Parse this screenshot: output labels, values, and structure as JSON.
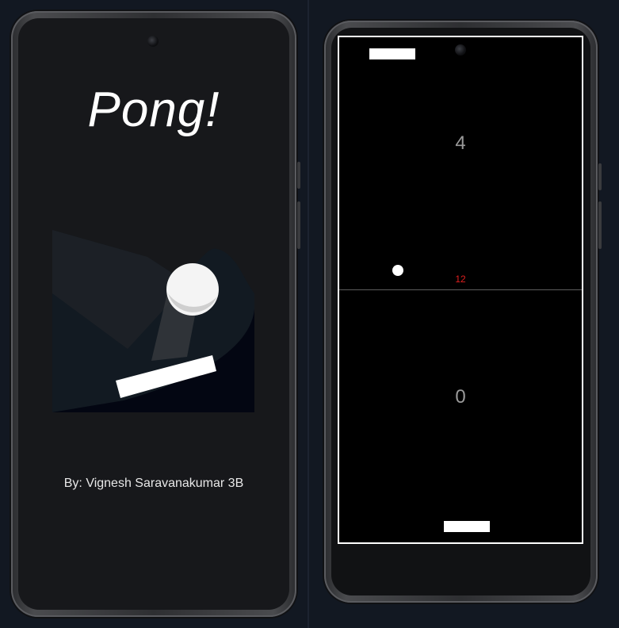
{
  "splash": {
    "title": "Pong!",
    "credit": "By: Vignesh Saravanakumar 3B"
  },
  "game": {
    "top_score": "4",
    "bottom_score": "0",
    "counter": "12"
  },
  "colors": {
    "background": "#121822",
    "splash_screen": "#17181b",
    "game_bg": "#000000",
    "counter": "#e01f1f",
    "score": "#9a9a9a"
  }
}
